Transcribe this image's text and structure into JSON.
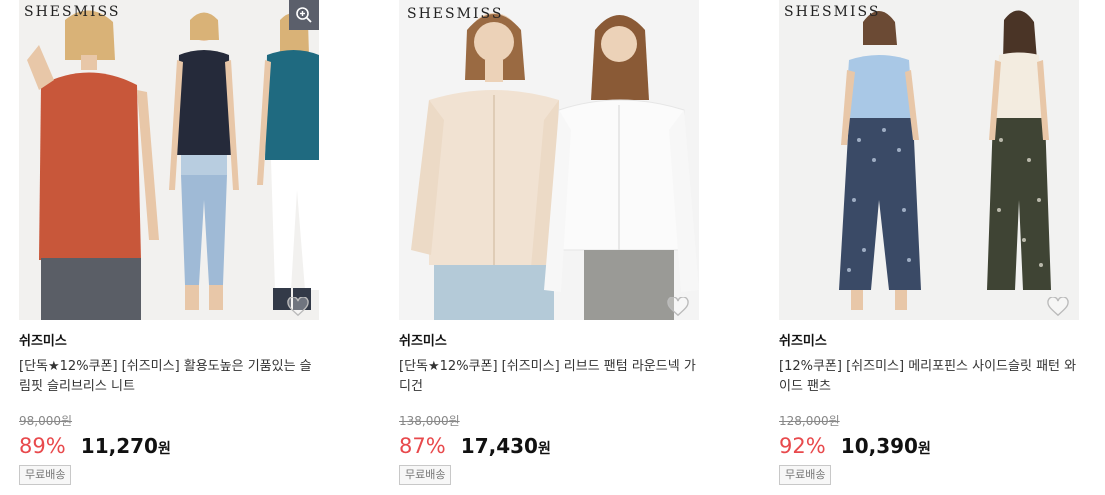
{
  "products": [
    {
      "brand_watermark": "SHESMISS",
      "seller": "쉬즈미스",
      "title": "[단독★12%쿠폰] [쉬즈미스] 활용도높은 기품있는 슬림핏 슬리브리스 니트",
      "original_price": "98,000원",
      "discount": "89%",
      "price": "11,270",
      "currency": "원",
      "shipping": "무료배송"
    },
    {
      "brand_watermark": "SHESMISS",
      "seller": "쉬즈미스",
      "title": "[단독★12%쿠폰] [쉬즈미스] 리브드 팬텀 라운드넥 가디건",
      "original_price": "138,000원",
      "discount": "87%",
      "price": "17,430",
      "currency": "원",
      "shipping": "무료배송"
    },
    {
      "brand_watermark": "SHESMISS",
      "seller": "쉬즈미스",
      "title": "[12%쿠폰] [쉬즈미스] 메리포핀스 사이드슬릿 패턴 와이드 팬츠",
      "original_price": "128,000원",
      "discount": "92%",
      "price": "10,390",
      "currency": "원",
      "shipping": "무료배송"
    }
  ],
  "colors": {
    "discount": "#e8494c",
    "zoom_button": "#5b5f6b",
    "orange_top": "#c8573a",
    "navy_top": "#252a3a",
    "teal_top": "#1f6a80",
    "cream_cardigan": "#f1e2d2",
    "white_cardigan": "#f8f8f8",
    "light_blue_top": "#a9c8e6",
    "floral_pants": "#3a4a66"
  },
  "icons": [
    "zoom-in-icon",
    "heart-outline-icon"
  ]
}
